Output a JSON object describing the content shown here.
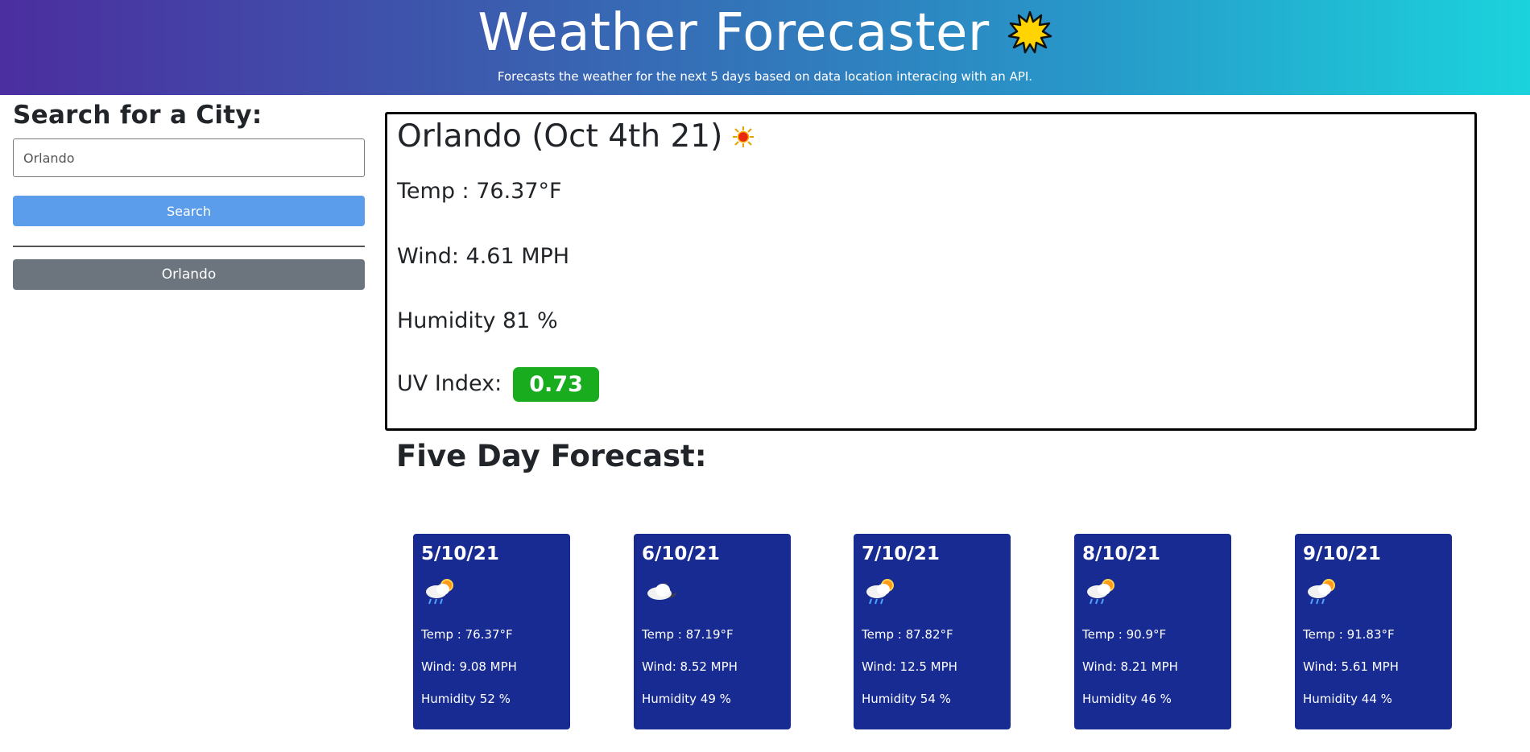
{
  "header": {
    "title": "Weather Forecaster",
    "subtitle": "Forecasts the weather for the next 5 days based on data location interacing with an API.",
    "icon": "sun-icon"
  },
  "sidebar": {
    "heading": "Search for a City:",
    "input_value": "Orlando",
    "search_label": "Search",
    "history": [
      "Orlando"
    ]
  },
  "current": {
    "heading": "Orlando (Oct 4th 21)",
    "icon": "sun-icon",
    "temp": "Temp : 76.37°F",
    "wind": "Wind: 4.61 MPH",
    "humidity": "Humidity 81 %",
    "uv_label": "UV Index:",
    "uv_value": "0.73",
    "uv_color": "#19ac1e"
  },
  "forecast": {
    "title": "Five Day Forecast:",
    "days": [
      {
        "date": "5/10/21",
        "icon": "rain-sun-icon",
        "temp": "Temp : 76.37°F",
        "wind": "Wind: 9.08 MPH",
        "humidity": "Humidity 52 %"
      },
      {
        "date": "6/10/21",
        "icon": "cloud-moon-icon",
        "temp": "Temp : 87.19°F",
        "wind": "Wind: 8.52 MPH",
        "humidity": "Humidity 49 %"
      },
      {
        "date": "7/10/21",
        "icon": "rain-sun-icon",
        "temp": "Temp : 87.82°F",
        "wind": "Wind: 12.5 MPH",
        "humidity": "Humidity 54 %"
      },
      {
        "date": "8/10/21",
        "icon": "rain-sun-icon",
        "temp": "Temp : 90.9°F",
        "wind": "Wind: 8.21 MPH",
        "humidity": "Humidity 46 %"
      },
      {
        "date": "9/10/21",
        "icon": "rain-sun-icon",
        "temp": "Temp : 91.83°F",
        "wind": "Wind: 5.61 MPH",
        "humidity": "Humidity 44 %"
      }
    ]
  },
  "colors": {
    "card": "#172b93",
    "search_button": "#5b9dea",
    "history_button": "#6c757d"
  }
}
